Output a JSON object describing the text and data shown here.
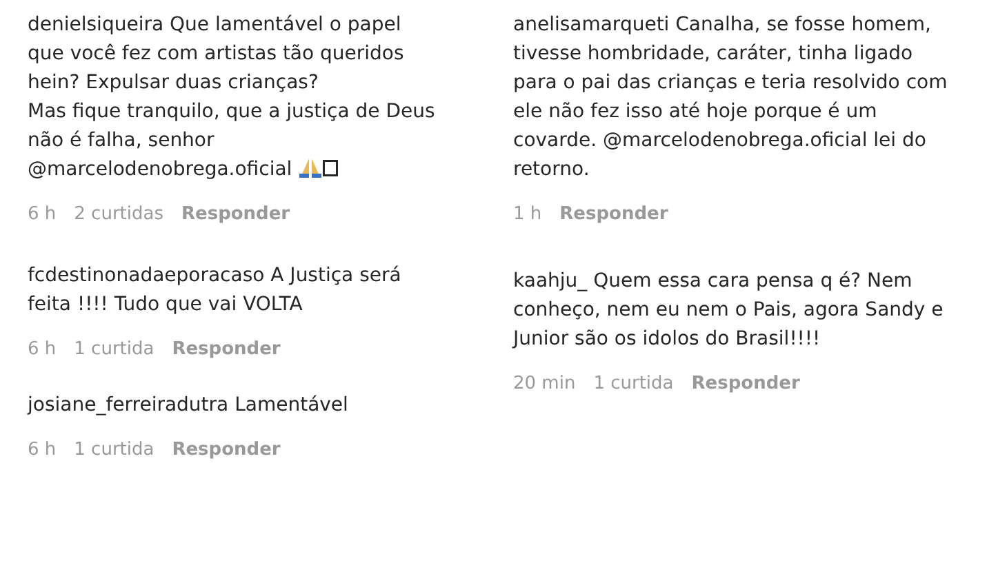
{
  "columns": [
    {
      "comments": [
        {
          "username": "denielsiqueira",
          "text": "Que lamentável o papel que você fez com artistas tão queridos hein? Expulsar duas crianças?\nMas fique tranquilo, que a justiça de Deus não é falha, senhor @marcelodenobrega.oficial",
          "has_emoji": true,
          "time": "6 h",
          "likes": "2 curtidas",
          "reply": "Responder"
        },
        {
          "username": "fcdestinonadaeporacaso",
          "text": "A Justiça será feita !!!! Tudo que vai VOLTA",
          "time": "6 h",
          "likes": "1 curtida",
          "reply": "Responder"
        },
        {
          "username": "josiane_ferreiradutra",
          "text": "Lamentável",
          "time": "6 h",
          "likes": "1 curtida",
          "reply": "Responder"
        }
      ]
    },
    {
      "comments": [
        {
          "username": "anelisamarqueti",
          "text": "Canalha, se fosse homem, tivesse hombridade, caráter, tinha ligado para o pai das crianças e teria resolvido com ele não fez isso até hoje porque é um covarde. @marcelodenobrega.oficial lei do retorno.",
          "time": "1 h",
          "reply": "Responder"
        },
        {
          "username": "kaahju_",
          "text": "Quem essa cara pensa q é? Nem conheço, nem eu nem o Pais, agora Sandy e Junior são os idolos do Brasil!!!!",
          "time": "20 min",
          "likes": "1 curtida",
          "reply": "Responder"
        }
      ]
    }
  ]
}
